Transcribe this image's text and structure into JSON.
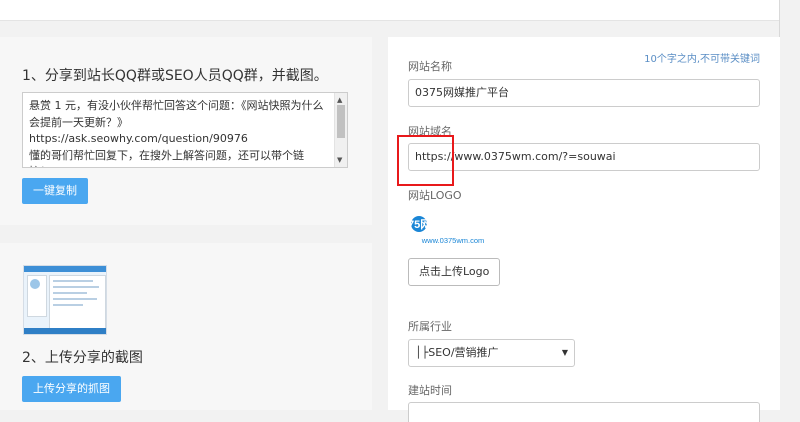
{
  "left": {
    "step1_title": "1、分享到站长QQ群或SEO人员QQ群，并截图。",
    "share_text": "悬赏 1 元，有没小伙伴帮忙回答这个问题：《网站快照为什么会提前一天更新？》\nhttps://ask.seowhy.com/question/90976\n懂的哥们帮忙回复下，在搜外上解答问题，还可以带个链\n接！",
    "copy_button": "一键复制",
    "step2_title": "2、上传分享的截图",
    "upload_screenshot_button": "上传分享的抓图"
  },
  "form": {
    "hint": "10个字之内,不可带关键词",
    "site_name_label": "网站名称",
    "site_name_value": "0375网媒推广平台",
    "site_domain_label": "网站域名",
    "site_domain_value": "https://www.0375wm.com/?=souwai",
    "logo_label": "网站LOGO",
    "logo_brand": "0375网媒",
    "logo_sub": "www.0375wm.com",
    "upload_logo_button": "点击上传Logo",
    "industry_label": "所属行业",
    "industry_value": "│├SEO/营销推广",
    "build_time_label": "建站时间"
  },
  "icons": {
    "scroll_up": "scroll-up-arrow-icon",
    "scroll_down": "scroll-down-arrow-icon",
    "select_caret": "caret-down-icon"
  },
  "colors": {
    "primary_button": "#4aa7f0",
    "highlight_box": "#e8191b",
    "hint_text": "#5a8ec5",
    "logo_orange": "#f39a1f",
    "logo_blue": "#1a86d6"
  }
}
